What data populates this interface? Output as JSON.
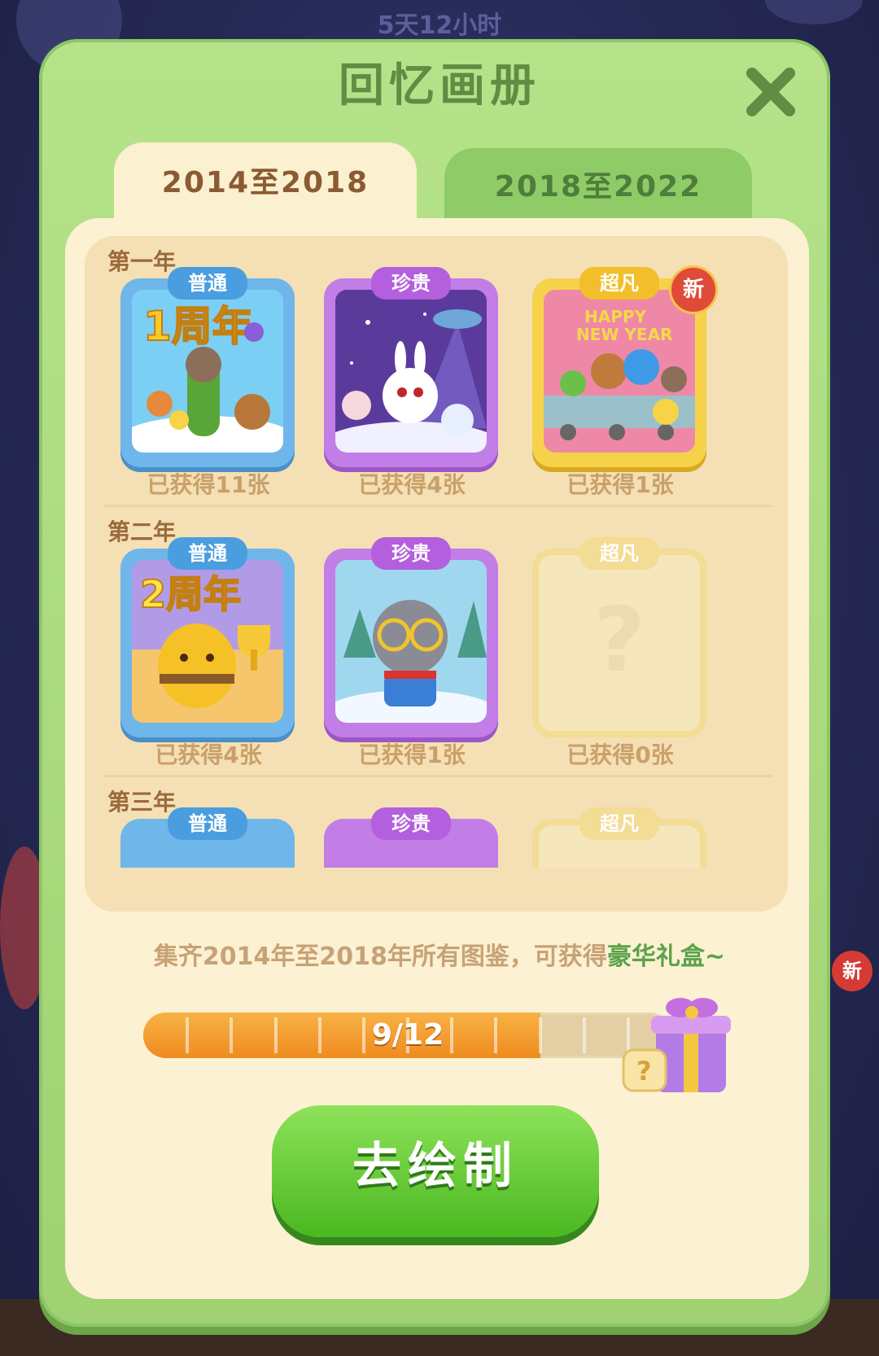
{
  "background": {
    "timer": "5天12小时",
    "side_badge": "新"
  },
  "dialog": {
    "title": "回忆画册",
    "close_icon": "close-icon",
    "tabs": [
      {
        "label": "2014至2018",
        "active": true
      },
      {
        "label": "2018至2022",
        "active": false
      }
    ],
    "years": [
      {
        "label": "第一年",
        "cards": [
          {
            "rarity": "普通",
            "count": "已获得11张",
            "new": false
          },
          {
            "rarity": "珍贵",
            "count": "已获得4张",
            "new": false
          },
          {
            "rarity": "超凡",
            "count": "已获得1张",
            "new": true,
            "new_label": "新"
          }
        ]
      },
      {
        "label": "第二年",
        "cards": [
          {
            "rarity": "普通",
            "count": "已获得4张",
            "new": false
          },
          {
            "rarity": "珍贵",
            "count": "已获得1张",
            "new": false
          },
          {
            "rarity": "超凡",
            "count": "已获得0张",
            "new": false,
            "locked": true,
            "placeholder": "?"
          }
        ]
      },
      {
        "label": "第三年",
        "cards": [
          {
            "rarity": "普通"
          },
          {
            "rarity": "珍贵"
          },
          {
            "rarity": "超凡"
          }
        ]
      }
    ],
    "description": {
      "prefix": "集齐2014年至2018年所有图鉴，可获得",
      "highlight": "豪华礼盒~"
    },
    "progress": {
      "current": 9,
      "total": 12,
      "label": "9/12"
    },
    "action_button": "去绘制"
  },
  "colors": {
    "panel_green": "#a8da7c",
    "common_blue": "#4a9ee0",
    "precious_purple": "#b35fde",
    "extraordinary_gold": "#f2bf2a",
    "button_green": "#4ab820"
  }
}
